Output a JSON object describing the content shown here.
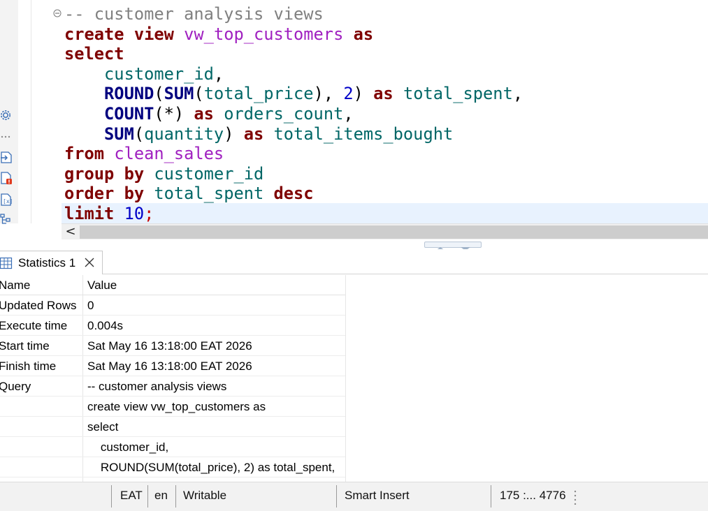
{
  "editor": {
    "code_lines": [
      [
        {
          "t": "-- customer analysis views",
          "c": "cm"
        }
      ],
      [
        {
          "t": "create",
          "c": "kw"
        },
        {
          "t": " ",
          "c": "pl"
        },
        {
          "t": "view",
          "c": "kw"
        },
        {
          "t": " ",
          "c": "pl"
        },
        {
          "t": "vw_top_customers",
          "c": "obj"
        },
        {
          "t": " ",
          "c": "pl"
        },
        {
          "t": "as",
          "c": "kw"
        }
      ],
      [
        {
          "t": "select",
          "c": "kw"
        }
      ],
      [
        {
          "t": "    ",
          "c": "pl"
        },
        {
          "t": "customer_id",
          "c": "id"
        },
        {
          "t": ",",
          "c": "pl"
        }
      ],
      [
        {
          "t": "    ",
          "c": "pl"
        },
        {
          "t": "ROUND",
          "c": "fn"
        },
        {
          "t": "(",
          "c": "pl"
        },
        {
          "t": "SUM",
          "c": "fn"
        },
        {
          "t": "(",
          "c": "pl"
        },
        {
          "t": "total_price",
          "c": "id"
        },
        {
          "t": "), ",
          "c": "pl"
        },
        {
          "t": "2",
          "c": "num"
        },
        {
          "t": ") ",
          "c": "pl"
        },
        {
          "t": "as",
          "c": "kw"
        },
        {
          "t": " ",
          "c": "pl"
        },
        {
          "t": "total_spent",
          "c": "id"
        },
        {
          "t": ",",
          "c": "pl"
        }
      ],
      [
        {
          "t": "    ",
          "c": "pl"
        },
        {
          "t": "COUNT",
          "c": "fn"
        },
        {
          "t": "(*) ",
          "c": "pl"
        },
        {
          "t": "as",
          "c": "kw"
        },
        {
          "t": " ",
          "c": "pl"
        },
        {
          "t": "orders_count",
          "c": "id"
        },
        {
          "t": ",",
          "c": "pl"
        }
      ],
      [
        {
          "t": "    ",
          "c": "pl"
        },
        {
          "t": "SUM",
          "c": "fn"
        },
        {
          "t": "(",
          "c": "pl"
        },
        {
          "t": "quantity",
          "c": "id"
        },
        {
          "t": ") ",
          "c": "pl"
        },
        {
          "t": "as",
          "c": "kw"
        },
        {
          "t": " ",
          "c": "pl"
        },
        {
          "t": "total_items_bought",
          "c": "id"
        }
      ],
      [
        {
          "t": "from",
          "c": "kw"
        },
        {
          "t": " ",
          "c": "pl"
        },
        {
          "t": "clean_sales",
          "c": "obj"
        }
      ],
      [
        {
          "t": "group",
          "c": "kw"
        },
        {
          "t": " ",
          "c": "pl"
        },
        {
          "t": "by",
          "c": "kw"
        },
        {
          "t": " ",
          "c": "pl"
        },
        {
          "t": "customer_id",
          "c": "id"
        }
      ],
      [
        {
          "t": "order",
          "c": "kw"
        },
        {
          "t": " ",
          "c": "pl"
        },
        {
          "t": "by",
          "c": "kw"
        },
        {
          "t": " ",
          "c": "pl"
        },
        {
          "t": "total_spent",
          "c": "id"
        },
        {
          "t": " ",
          "c": "pl"
        },
        {
          "t": "desc",
          "c": "kw"
        }
      ],
      [
        {
          "t": "limit",
          "c": "kw"
        },
        {
          "t": " ",
          "c": "pl"
        },
        {
          "t": "10",
          "c": "num"
        },
        {
          "t": ";",
          "c": "semi"
        }
      ]
    ],
    "scroll_left_glyph": "<",
    "left_rail_icons": [
      "gear-icon",
      "more-icon",
      "execute-script-icon",
      "script-error-icon",
      "variables-icon",
      "outline-icon"
    ]
  },
  "results": {
    "tab_label": "Statistics 1",
    "tab_icon": "grid-icon",
    "headers": {
      "name": "Name",
      "value": "Value"
    },
    "rows": [
      {
        "name": "Updated Rows",
        "value": "0"
      },
      {
        "name": "Execute time",
        "value": "0.004s"
      },
      {
        "name": "Start time",
        "value": "Sat May 16 13:18:00 EAT 2026"
      },
      {
        "name": "Finish time",
        "value": "Sat May 16 13:18:00 EAT 2026"
      },
      {
        "name": "Query",
        "value": "-- customer analysis views"
      },
      {
        "name": "",
        "value": "create view vw_top_customers as"
      },
      {
        "name": "",
        "value": "select"
      },
      {
        "name": "",
        "value": "    customer_id,"
      },
      {
        "name": "",
        "value": "    ROUND(SUM(total_price), 2) as total_spent,"
      }
    ]
  },
  "statusbar": {
    "timezone": "EAT",
    "locale": "en",
    "mode": "Writable",
    "insert_mode": "Smart Insert",
    "position": "175 :... 4776"
  },
  "colors": {
    "keyword": "#7f0000",
    "function": "#00007f",
    "identifier": "#006666",
    "object": "#a020c0",
    "comment": "#808080",
    "number": "#0000c8",
    "current_line": "#e8f2fe"
  }
}
